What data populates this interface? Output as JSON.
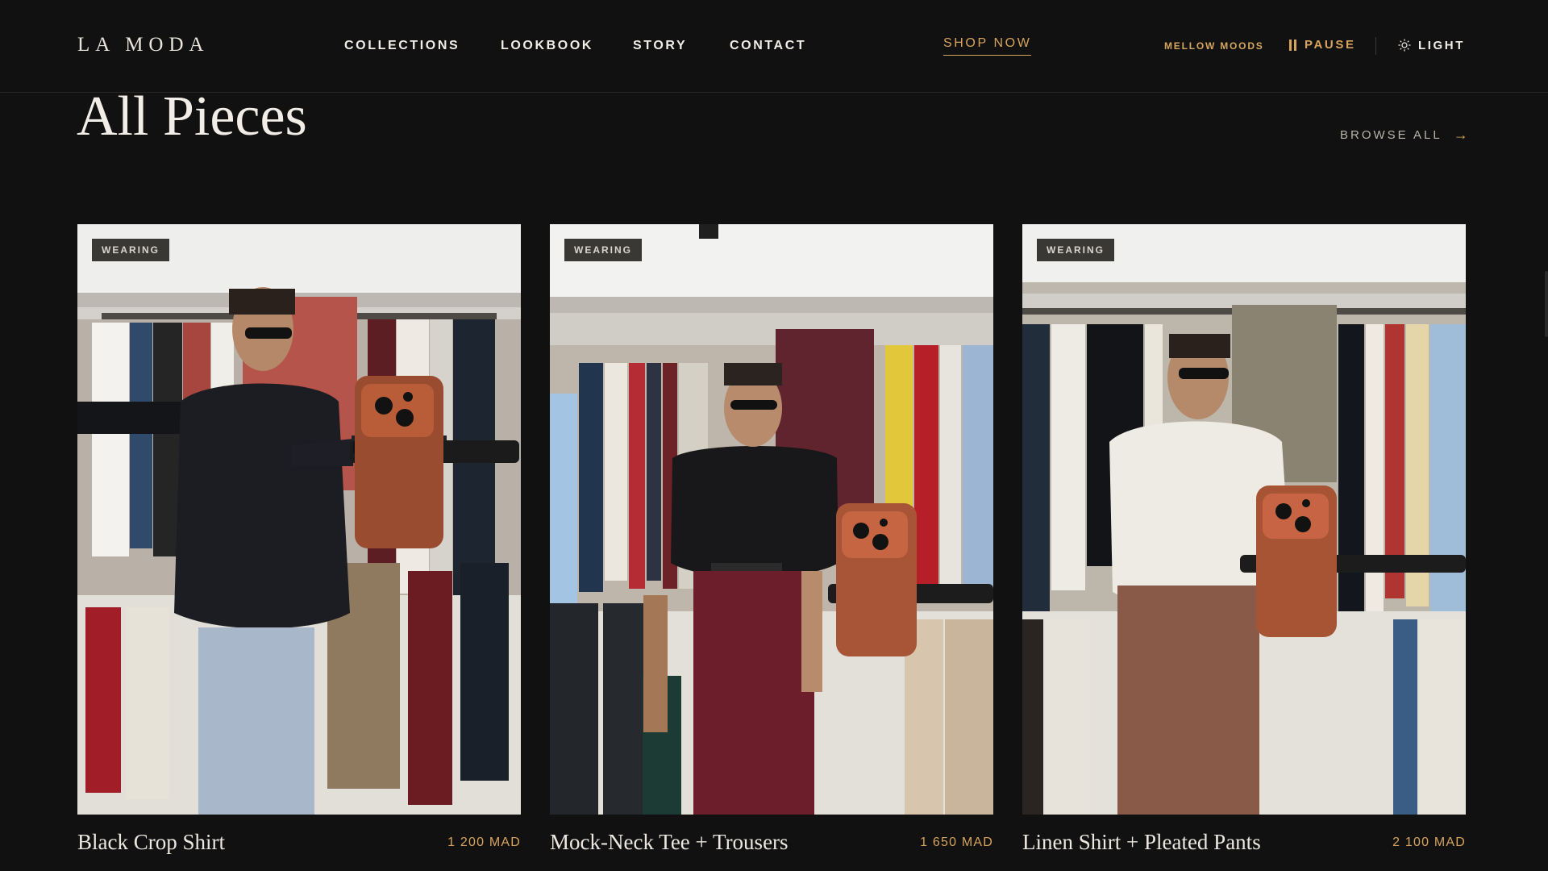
{
  "brand": {
    "logo": "LA MODA"
  },
  "nav": {
    "collections": "COLLECTIONS",
    "lookbook": "LOOKBOOK",
    "story": "STORY",
    "contact": "CONTACT",
    "shop_now": "SHOP NOW"
  },
  "controls": {
    "mood": "MELLOW MOODS",
    "pause": "PAUSE",
    "light": "LIGHT"
  },
  "section": {
    "title": "All Pieces",
    "browse_all": "BROWSE ALL",
    "browse_arrow": "→"
  },
  "products": [
    {
      "badge": "WEARING",
      "name": "Black Crop Shirt",
      "price": "1 200 MAD",
      "top_color": "#1c1d22",
      "bottom_color": "#a8b7c9"
    },
    {
      "badge": "WEARING",
      "name": "Mock-Neck Tee + Trousers",
      "price": "1 650 MAD",
      "top_color": "#18181b",
      "bottom_color": "#6c1f2a"
    },
    {
      "badge": "WEARING",
      "name": "Linen Shirt + Pleated Pants",
      "price": "2 100 MAD",
      "top_color": "#eeebe4",
      "bottom_color": "#8a5a49"
    }
  ],
  "colors": {
    "accent": "#d7a45d",
    "background": "#111111",
    "text": "#ece8e1"
  },
  "icons": [
    "pause-icon",
    "sun-icon",
    "arrow-right-icon"
  ]
}
